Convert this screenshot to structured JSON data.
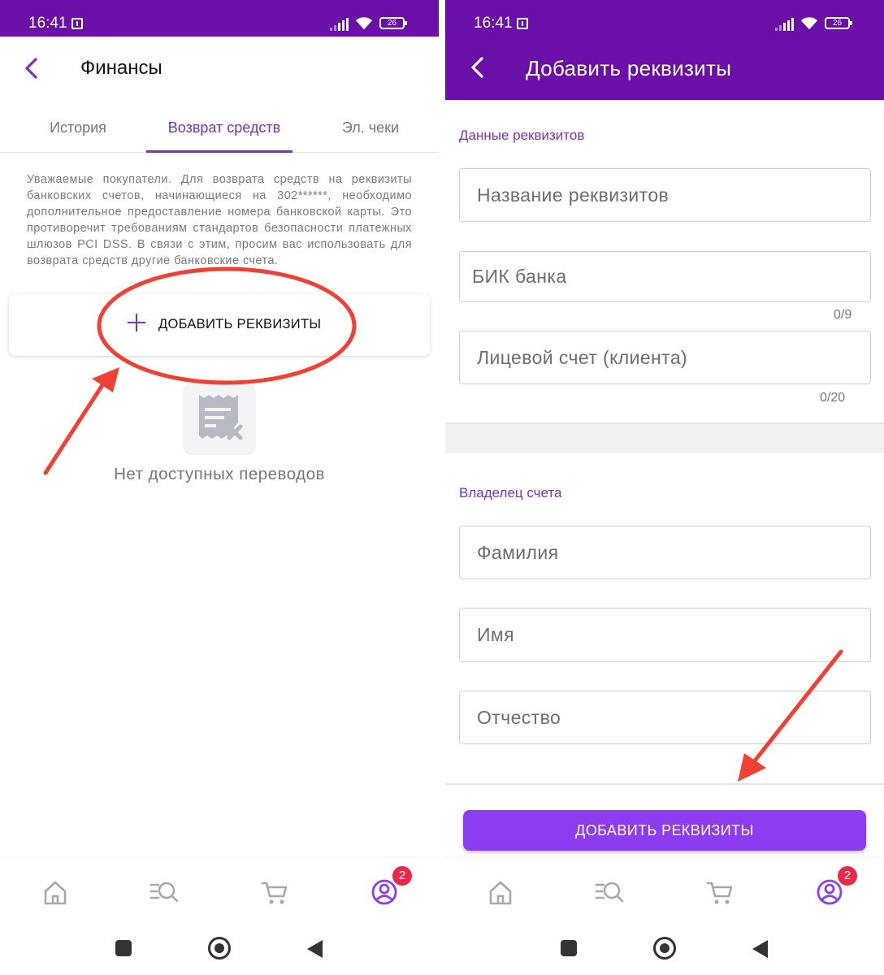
{
  "status_bar": {
    "time": "16:41",
    "battery": "26"
  },
  "left_screen": {
    "header": {
      "title": "Финансы"
    },
    "tabs": [
      {
        "label": "История",
        "active": false
      },
      {
        "label": "Возврат средств",
        "active": true
      },
      {
        "label": "Эл. чеки",
        "active": false
      }
    ],
    "notice": "Уважаемые покупатели. Для возврата средств на реквизиты банковских счетов, начинающиеся на 302******, необходимо дополнительное предоставление номера банковской карты. Это противоречит требованиям стандартов безопасности платежных шлюзов PCI DSS. В связи с этим, просим вас использовать для возврата средств другие банковские счета.",
    "add_button_label": "ДОБАВИТЬ РЕКВИЗИТЫ",
    "empty_state": "Нет доступных переводов"
  },
  "right_screen": {
    "header": {
      "title": "Добавить реквизиты"
    },
    "section_details": "Данные реквизитов",
    "fields": {
      "requisites_name": {
        "placeholder": "Название реквизитов"
      },
      "bik": {
        "placeholder": "БИК банка",
        "counter": "0/9"
      },
      "account": {
        "placeholder": "Лицевой счет (клиента)",
        "counter": "0/20"
      }
    },
    "section_owner": "Владелец счета",
    "owner_fields": {
      "surname": {
        "placeholder": "Фамилия"
      },
      "name": {
        "placeholder": "Имя"
      },
      "patronymic": {
        "placeholder": "Отчество"
      }
    },
    "submit_label": "ДОБАВИТЬ РЕКВИЗИТЫ"
  },
  "bottom_nav": {
    "items": [
      {
        "icon": "home-icon"
      },
      {
        "icon": "catalog-search-icon"
      },
      {
        "icon": "cart-icon"
      },
      {
        "icon": "profile-icon",
        "badge": "2"
      }
    ]
  },
  "colors": {
    "brand": "#6a0fa8",
    "accent": "#7b2fc9",
    "button": "#8d3df0",
    "badge": "#e8294a",
    "annotation": "#ef4135"
  }
}
